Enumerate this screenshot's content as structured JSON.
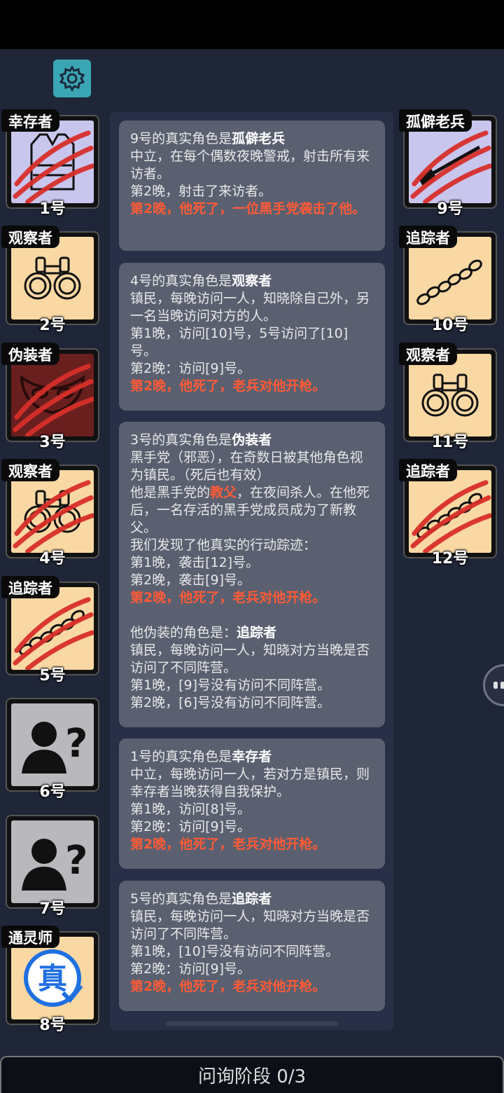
{
  "status_bar": {},
  "settings": {
    "icon": "gear-icon"
  },
  "left_players": [
    {
      "role": "幸存者",
      "seat": "1号",
      "icon": "vest-icon",
      "bg": "lav",
      "dead": true
    },
    {
      "role": "观察者",
      "seat": "2号",
      "icon": "binoculars-icon",
      "bg": "cream",
      "dead": false
    },
    {
      "role": "伪装者",
      "seat": "3号",
      "icon": "mask-icon",
      "bg": "red",
      "dead": true
    },
    {
      "role": "观察者",
      "seat": "4号",
      "icon": "binoculars-icon",
      "bg": "cream",
      "dead": true
    },
    {
      "role": "追踪者",
      "seat": "5号",
      "icon": "footprints-icon",
      "bg": "cream",
      "dead": true
    },
    {
      "role": "",
      "seat": "6号",
      "icon": "unknown-person-icon",
      "bg": "grey",
      "dead": false
    },
    {
      "role": "",
      "seat": "7号",
      "icon": "unknown-person-icon",
      "bg": "grey",
      "dead": false
    },
    {
      "role": "通灵师",
      "seat": "8号",
      "icon": "verified-true-badge-icon",
      "bg": "cream",
      "dead": false
    }
  ],
  "right_players": [
    {
      "role": "孤僻老兵",
      "seat": "9号",
      "icon": "rifle-icon",
      "bg": "lav",
      "dead": true
    },
    {
      "role": "追踪者",
      "seat": "10号",
      "icon": "footprints-icon",
      "bg": "cream",
      "dead": false
    },
    {
      "role": "观察者",
      "seat": "11号",
      "icon": "binoculars-icon",
      "bg": "cream",
      "dead": false
    },
    {
      "role": "追踪者",
      "seat": "12号",
      "icon": "footprints-icon",
      "bg": "cream",
      "dead": true
    }
  ],
  "badge_text": "真",
  "messages": [
    {
      "title_prefix": "9号的真实角色是",
      "title_role": "孤僻老兵",
      "lines": [
        "中立，在每个偶数夜晚警戒，射击所有来访者。",
        "第2晚，射击了来访者。"
      ],
      "death": "第2晚，他死了，一位黑手党袭击了他。"
    },
    {
      "title_prefix": "4号的真实角色是",
      "title_role": "观察者",
      "lines": [
        "镇民，每晚访问一人，知晓除自己外，另一名当晚访问对方的人。",
        "第1晚，访问[10]号，5号访问了[10]号。",
        "第2晚：访问[9]号。"
      ],
      "death": "第2晚，他死了，老兵对他开枪。"
    },
    {
      "title_prefix": "3号的真实角色是",
      "title_role": "伪装者",
      "line1": "黑手党（邪恶），在奇数日被其他角色视为镇民。（死后也有效）",
      "line2_pre": "他是黑手党的",
      "line2_hl": "教父",
      "line2_post": "，在夜间杀人。在他死后，一名存活的黑手党成员成为了新教父。",
      "line3": "我们发现了他真实的行动踪迹：",
      "line4": "第1晚，袭击[12]号。",
      "line5": "第2晚，袭击[9]号。",
      "death": "第2晚，他死了，老兵对他开枪。",
      "disguise_prefix": "他伪装的角色是：",
      "disguise_role": "追踪者",
      "disguise_lines": [
        "镇民，每晚访问一人，知晓对方当晚是否访问了不同阵营。",
        "第1晚，[9]号没有访问不同阵营。",
        "第2晚，[6]号没有访问不同阵营。"
      ]
    },
    {
      "title_prefix": "1号的真实角色是",
      "title_role": "幸存者",
      "lines": [
        "中立，每晚访问一人，若对方是镇民，则幸存者当晚获得自我保护。",
        "第1晚，访问[8]号。",
        "第2晚：访问[9]号。"
      ],
      "death": "第2晚，他死了，老兵对他开枪。"
    },
    {
      "title_prefix": "5号的真实角色是",
      "title_role": "追踪者",
      "lines": [
        "镇民，每晚访问一人，知晓对方当晚是否访问了不同阵营。",
        "第1晚，[10]号没有访问不同阵营。",
        "第2晚：访问[9]号。"
      ],
      "death": "第2晚，他死了，老兵对他开枪。"
    }
  ],
  "bottom": {
    "phase_label": "问询阶段 0/3"
  }
}
